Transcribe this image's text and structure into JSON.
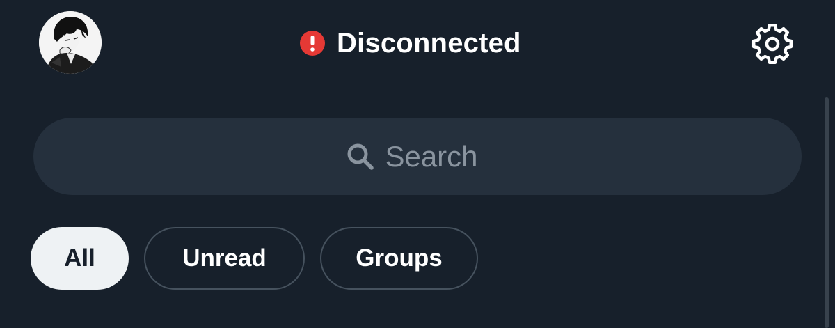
{
  "header": {
    "status_text": "Disconnected",
    "status_icon": "alert-circle-icon",
    "status_color": "#e53935",
    "settings_icon": "gear-icon"
  },
  "search": {
    "placeholder": "Search",
    "icon": "search-icon"
  },
  "filters": {
    "selected": "All",
    "chips": [
      {
        "label": "All"
      },
      {
        "label": "Unread"
      },
      {
        "label": "Groups"
      }
    ]
  },
  "colors": {
    "background": "#17202b",
    "search_background": "#25303d",
    "chip_selected_background": "#eef2f4",
    "chip_border": "#46525e"
  }
}
